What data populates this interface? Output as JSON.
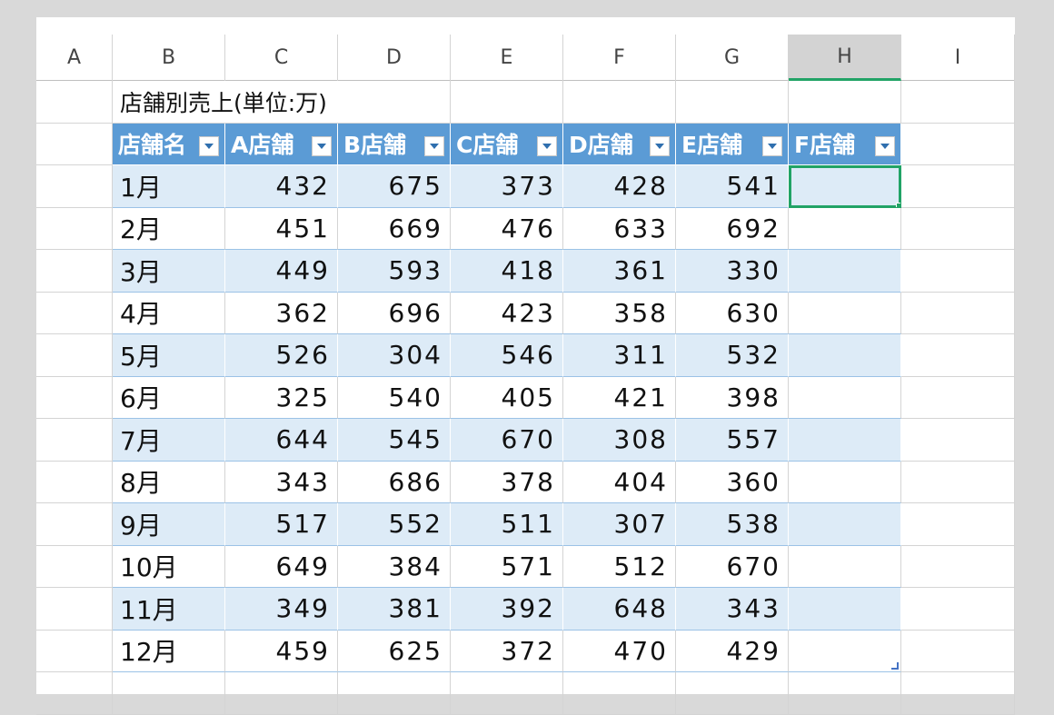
{
  "columns": [
    "A",
    "B",
    "C",
    "D",
    "E",
    "F",
    "G",
    "H",
    "I"
  ],
  "title": "店舗別売上(単位:万)",
  "headers": [
    "店舗名",
    "A店舗",
    "B店舗",
    "C店舗",
    "D店舗",
    "E店舗",
    "F店舗"
  ],
  "rows": [
    {
      "month": "1月",
      "values": [
        "432",
        "675",
        "373",
        "428",
        "541"
      ]
    },
    {
      "month": "2月",
      "values": [
        "451",
        "669",
        "476",
        "633",
        "692"
      ]
    },
    {
      "month": "3月",
      "values": [
        "449",
        "593",
        "418",
        "361",
        "330"
      ]
    },
    {
      "month": "4月",
      "values": [
        "362",
        "696",
        "423",
        "358",
        "630"
      ]
    },
    {
      "month": "5月",
      "values": [
        "526",
        "304",
        "546",
        "311",
        "532"
      ]
    },
    {
      "month": "6月",
      "values": [
        "325",
        "540",
        "405",
        "421",
        "398"
      ]
    },
    {
      "month": "7月",
      "values": [
        "644",
        "545",
        "670",
        "308",
        "557"
      ]
    },
    {
      "month": "8月",
      "values": [
        "343",
        "686",
        "378",
        "404",
        "360"
      ]
    },
    {
      "month": "9月",
      "values": [
        "517",
        "552",
        "511",
        "307",
        "538"
      ]
    },
    {
      "month": "10月",
      "values": [
        "649",
        "384",
        "571",
        "512",
        "670"
      ]
    },
    {
      "month": "11月",
      "values": [
        "349",
        "381",
        "392",
        "648",
        "343"
      ]
    },
    {
      "month": "12月",
      "values": [
        "459",
        "625",
        "372",
        "470",
        "429"
      ]
    }
  ],
  "selected_cell": "H4",
  "icons": {
    "filter": "filter-dropdown-icon",
    "resize": "table-resize-handle-icon"
  },
  "colors": {
    "header_fill": "#5b9bd5",
    "band_fill": "#ddebf7",
    "selection": "#21a366"
  }
}
